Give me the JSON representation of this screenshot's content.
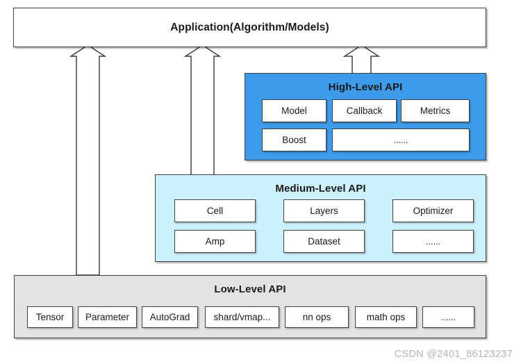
{
  "diagram": {
    "title": "Application(Algorithm/Models)",
    "watermark": "CSDN @2401_86123237"
  },
  "application": {
    "label": "Application(Algorithm/Models)"
  },
  "high_level": {
    "title": "High-Level API",
    "color": "#3D9BE9",
    "items": [
      {
        "label": "Model"
      },
      {
        "label": "Callback"
      },
      {
        "label": "Metrics"
      },
      {
        "label": "Boost"
      },
      {
        "label": "......"
      }
    ]
  },
  "medium_level": {
    "title": "Medium-Level API",
    "color": "#CCF0FC",
    "items": [
      {
        "label": "Cell"
      },
      {
        "label": "Layers"
      },
      {
        "label": "Optimizer"
      },
      {
        "label": "Amp"
      },
      {
        "label": "Dataset"
      },
      {
        "label": "......"
      }
    ]
  },
  "low_level": {
    "title": "Low-Level API",
    "color": "#E3E3E3",
    "items": [
      {
        "label": "Tensor"
      },
      {
        "label": "Parameter"
      },
      {
        "label": "AutoGrad"
      },
      {
        "label": "shard/vmap..."
      },
      {
        "label": "nn ops"
      },
      {
        "label": "math ops"
      },
      {
        "label": "......"
      }
    ]
  },
  "arrows": [
    {
      "name": "low-level-to-application"
    },
    {
      "name": "medium-level-to-application"
    },
    {
      "name": "high-level-to-application"
    }
  ]
}
